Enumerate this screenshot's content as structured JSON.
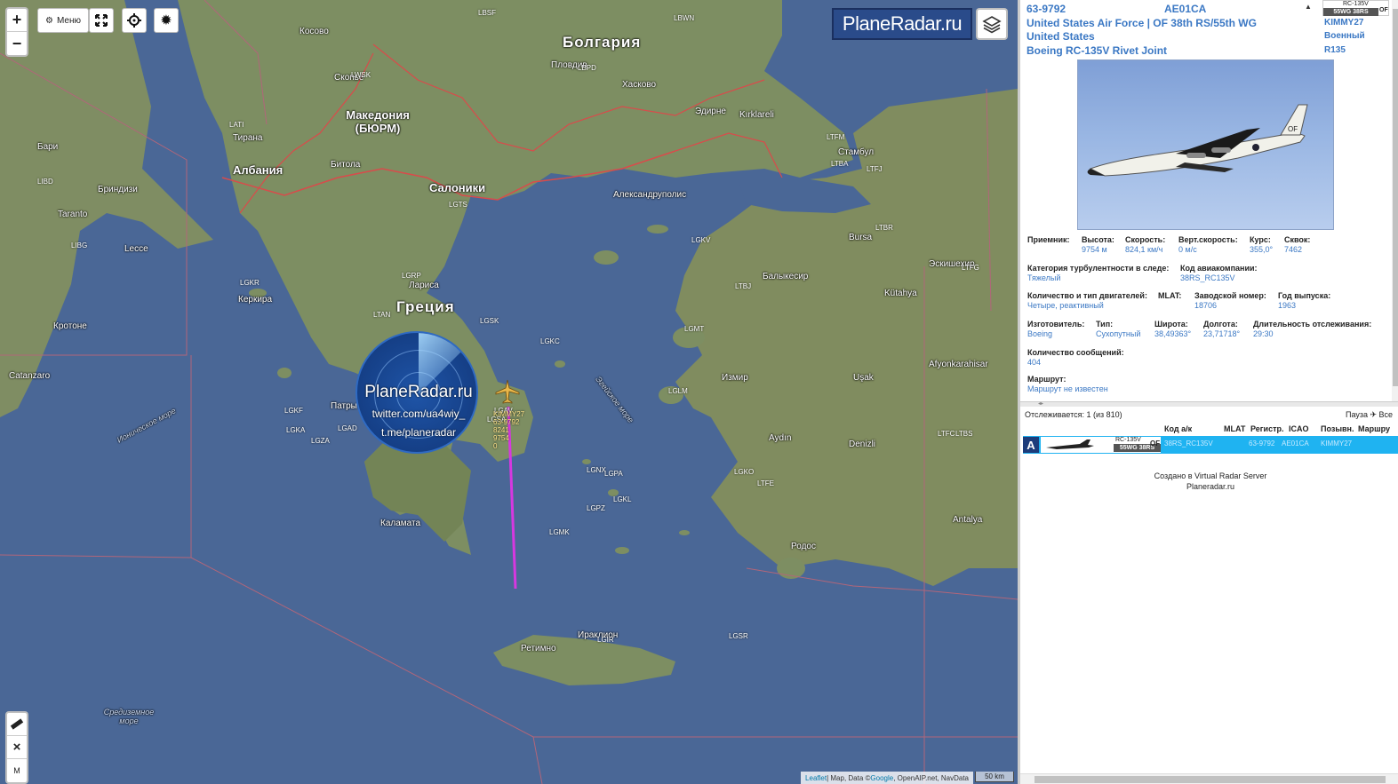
{
  "map": {
    "controls": {
      "zoom_in": "+",
      "zoom_out": "−",
      "menu_label": "Меню",
      "measure_close": "×",
      "measure_m": "M"
    },
    "brand": "PlaneRadar.ru",
    "watermark": {
      "title": "PlaneRadar.ru",
      "twitter": "twitter.com/ua4wiy_",
      "telegram": "t.me/planeradar"
    },
    "labels": {
      "bulgaria": "Болгария",
      "greece": "Греция",
      "albania": "Албания",
      "macedonia": "Македония (БЮРМ)",
      "skopje": "Скопье",
      "kosovo": "Косово",
      "thessaloniki": "Салоники",
      "larisa": "Лариса",
      "bitola": "Битола",
      "tirana": "Тирана",
      "plovdiv": "Пловдив",
      "haskovo": "Хасково",
      "istanbul": "Стамбул",
      "bursa": "Bursa",
      "balikesir": "Балыкесир",
      "izmir": "Измир",
      "aydin": "Aydın",
      "denizli": "Denizli",
      "eskisehir": "Эскишехир",
      "kutahya": "Kütahya",
      "bari": "Бари",
      "brindisi": "Бриндизи",
      "taranto": "Taranto",
      "lecce": "Lecce",
      "crotone": "Кротоне",
      "catanzaro": "Catanzaro",
      "kerkyra": "Керкира",
      "patra": "Патры",
      "kalamata": "Каламата",
      "irakleion": "Ираклион",
      "rethymno": "Ретимно",
      "rodos": "Родос",
      "antalya": "Antalya",
      "afyon": "Afyonkarahisar",
      "usak": "Uşak",
      "kirklareli": "Kırklareli",
      "edirne": "Эдирне",
      "alexandroupoli": "Александруполис",
      "aegean_sea": "Эгейское море",
      "ionian_sea": "Ионическое море",
      "mediterranean_sea": "Средиземное море"
    },
    "airports": [
      "LWSK",
      "LATI",
      "LGKR",
      "LGTS",
      "LGAV",
      "LGIR",
      "LGRP",
      "LTBS",
      "LGMT",
      "LTFM",
      "LTBA",
      "LTFJ",
      "LTFE",
      "LTFC",
      "LGKO",
      "LGKL",
      "LGPZ",
      "LGSA",
      "LGKV",
      "LTBJ",
      "LTBR",
      "LGLM",
      "LGSK",
      "LGKA",
      "LIBD",
      "LIBG",
      "LBSF",
      "LBPD",
      "LBWN",
      "LGSR",
      "LGMK",
      "LGNX",
      "LGPA",
      "LTAN",
      "LTFG",
      "LGKF",
      "LGZA",
      "LGAD",
      "LGKC"
    ],
    "flight_tag": [
      "KIMMY27",
      "63-9792",
      "8241",
      "9754",
      "0"
    ],
    "attribution": {
      "leaflet": "Leaflet",
      "sep": " | Map, Data © ",
      "google": "Google",
      "rest": ", OpenAIP.net, NavData"
    },
    "scale": "50 km"
  },
  "detail": {
    "registration": "63-9792",
    "icao": "AE01CA",
    "operator": "United States Air Force | OF 38th RS/55th WG",
    "country": "United States",
    "model": "Boeing RC-135V Rivet Joint",
    "thumb_type": "RC-135V",
    "thumb_tail": "55WG 38RS",
    "thumb_of": "OF",
    "callsign": "KIMMY27",
    "species": "Военный",
    "type_code": "R135",
    "fields": {
      "receiver": {
        "label": "Приемник:",
        "value": ""
      },
      "altitude": {
        "label": "Высота:",
        "value": "9754 м"
      },
      "speed": {
        "label": "Скорость:",
        "value": "824,1 км/ч"
      },
      "vspeed": {
        "label": "Верт.скорость:",
        "value": "0 м/с"
      },
      "heading": {
        "label": "Курс:",
        "value": "355,0°"
      },
      "squawk": {
        "label": "Сквок:",
        "value": "7462"
      },
      "wake": {
        "label": "Категория турбулентности в следе:",
        "value": "Тяжелый"
      },
      "airline_code": {
        "label": "Код авиакомпании:",
        "value": "38RS_RC135V"
      },
      "engines": {
        "label": "Количество и тип двигателей:",
        "value": "Четыре, реактивный"
      },
      "mlat": {
        "label": "MLAT:",
        "value": ""
      },
      "serial": {
        "label": "Заводской номер:",
        "value": "18706"
      },
      "year": {
        "label": "Год выпуска:",
        "value": "1963"
      },
      "manufacturer": {
        "label": "Изготовитель:",
        "value": "Boeing"
      },
      "kind": {
        "label": "Тип:",
        "value": "Сухопутный"
      },
      "lat": {
        "label": "Широта:",
        "value": "38,49363°"
      },
      "lon": {
        "label": "Долгота:",
        "value": "23,71718°"
      },
      "duration": {
        "label": "Длительность отслеживания:",
        "value": "29:30"
      },
      "messages": {
        "label": "Количество сообщений:",
        "value": "404"
      },
      "route": {
        "label": "Маршрут:",
        "value": "Маршрут не известен"
      }
    }
  },
  "list": {
    "tracking": "Отслеживается: 1 (из 810)",
    "pause": "Пауза ✈ Все",
    "columns": {
      "airline_code": "Код а/к",
      "mlat": "MLAT",
      "registration": "Регистр.",
      "icao": "ICAO",
      "callsign": "Позывн.",
      "route": "Маршру"
    },
    "row": {
      "badge": "A",
      "type": "RC-135V",
      "tail": "55WG 38RS",
      "of": "OF",
      "airline_code": "38RS_RC135V",
      "registration": "63-9792",
      "icao": "AE01CA",
      "callsign": "KIMMY27"
    },
    "credit_line1": "Создано в Virtual Radar Server",
    "credit_line2": "Planeradar.ru"
  },
  "colors": {
    "sea": "#4a6796",
    "land": "#7d8e62",
    "accent": "#3b78c4",
    "row_highlight": "#1fb3f1",
    "track": "#d638e0"
  }
}
